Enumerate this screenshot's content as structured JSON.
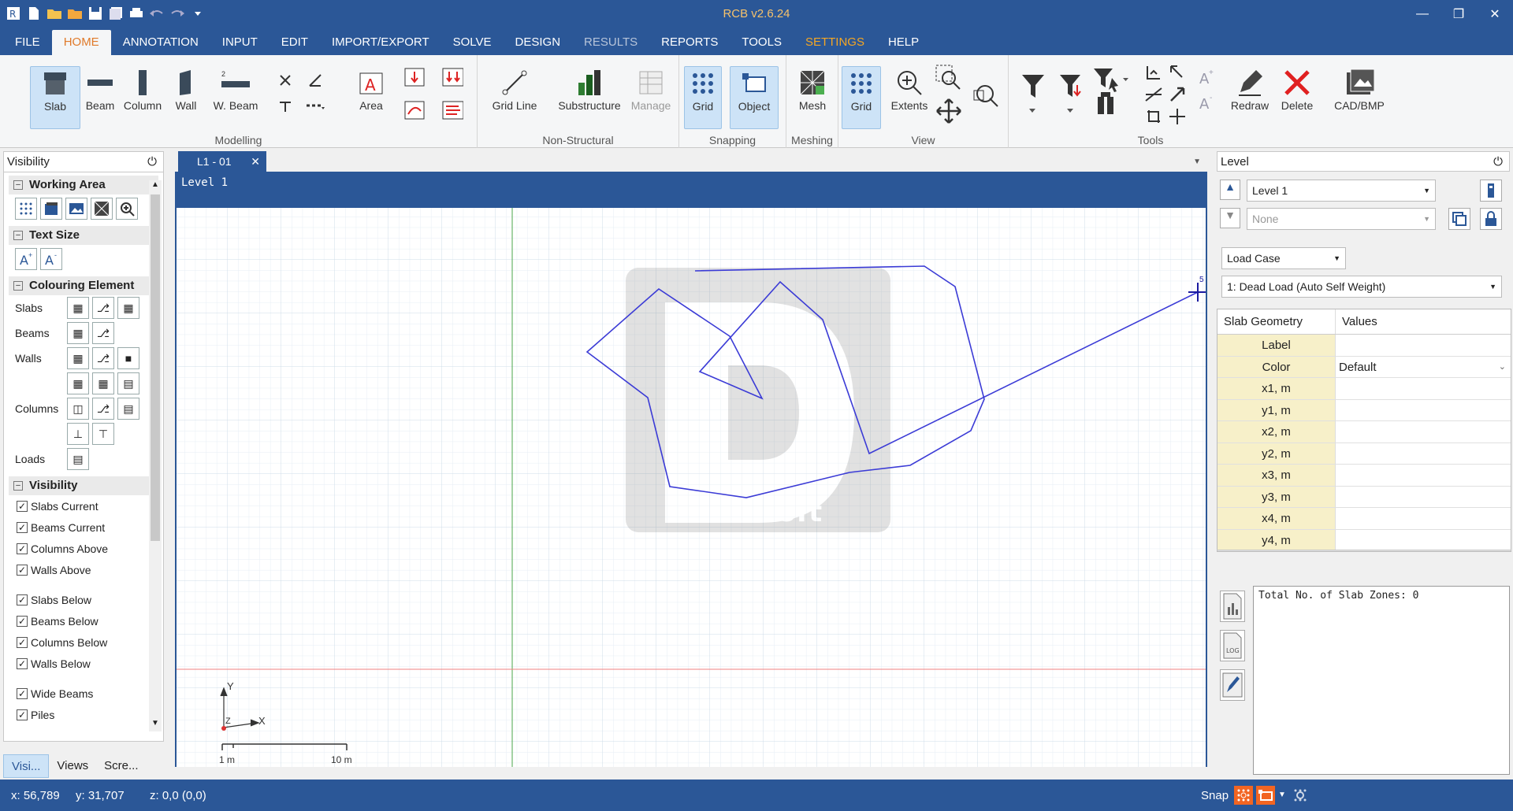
{
  "app": {
    "title": "RCB v2.6.24"
  },
  "menu": [
    "FILE",
    "HOME",
    "ANNOTATION",
    "INPUT",
    "EDIT",
    "IMPORT/EXPORT",
    "SOLVE",
    "DESIGN",
    "RESULTS",
    "REPORTS",
    "TOOLS",
    "SETTINGS",
    "HELP"
  ],
  "ribbon": {
    "modelling": {
      "label": "Modelling",
      "slab": "Slab",
      "beam": "Beam",
      "column": "Column",
      "wall": "Wall",
      "wbeam": "W. Beam",
      "area": "Area"
    },
    "nonstructural": {
      "label": "Non-Structural",
      "gridline": "Grid Line",
      "substructure": "Substructure",
      "manage": "Manage"
    },
    "snapping": {
      "label": "Snapping",
      "grid": "Grid",
      "object": "Object"
    },
    "meshing": {
      "label": "Meshing",
      "mesh": "Mesh"
    },
    "view": {
      "label": "View",
      "grid": "Grid",
      "extents": "Extents"
    },
    "tools": {
      "label": "Tools",
      "redraw": "Redraw",
      "delete": "Delete",
      "cad": "CAD/BMP"
    }
  },
  "left_panel": {
    "title": "Visibility",
    "sections": {
      "working_area": "Working Area",
      "text_size": "Text Size",
      "colouring": "Colouring Element",
      "visibility": "Visibility"
    },
    "colour_rows": [
      "Slabs",
      "Beams",
      "Walls",
      "Columns",
      "Loads"
    ],
    "checks": [
      "Slabs Current",
      "Beams Current",
      "Columns Above",
      "Walls Above",
      "Slabs Below",
      "Beams Below",
      "Columns Below",
      "Walls Below",
      "Wide Beams",
      "Piles"
    ],
    "tabs": [
      "Visi...",
      "Views",
      "Scre..."
    ]
  },
  "document": {
    "tab": "L1 - 01",
    "level_label": "Level 1",
    "watermark": "DiPCSoft",
    "axis_y": "Y",
    "axis_x": "X",
    "axis_z": "Z",
    "scale_start": "1 m",
    "scale_end": "10 m",
    "cursor_label": "5"
  },
  "right_panel": {
    "title": "Level",
    "level": "Level 1",
    "none": "None",
    "load_case_label": "Load Case",
    "load_case": "1: Dead Load (Auto Self Weight)",
    "table_headers": [
      "Slab Geometry",
      "Values"
    ],
    "rows": [
      {
        "k": "Label",
        "v": ""
      },
      {
        "k": "Color",
        "v": "Default"
      },
      {
        "k": "x1, m",
        "v": ""
      },
      {
        "k": "y1, m",
        "v": ""
      },
      {
        "k": "x2, m",
        "v": ""
      },
      {
        "k": "y2, m",
        "v": ""
      },
      {
        "k": "x3, m",
        "v": ""
      },
      {
        "k": "y3, m",
        "v": ""
      },
      {
        "k": "x4, m",
        "v": ""
      },
      {
        "k": "y4, m",
        "v": ""
      }
    ],
    "log_text": "Total No. of Slab Zones: 0"
  },
  "status": {
    "x": "x: 56,789",
    "y": "y: 31,707",
    "z": "z: 0,0 (0,0)",
    "snap": "Snap"
  },
  "colors": {
    "accent": "#2b5797",
    "title": "#f6c26b",
    "polyline": "#3b3bd6"
  }
}
